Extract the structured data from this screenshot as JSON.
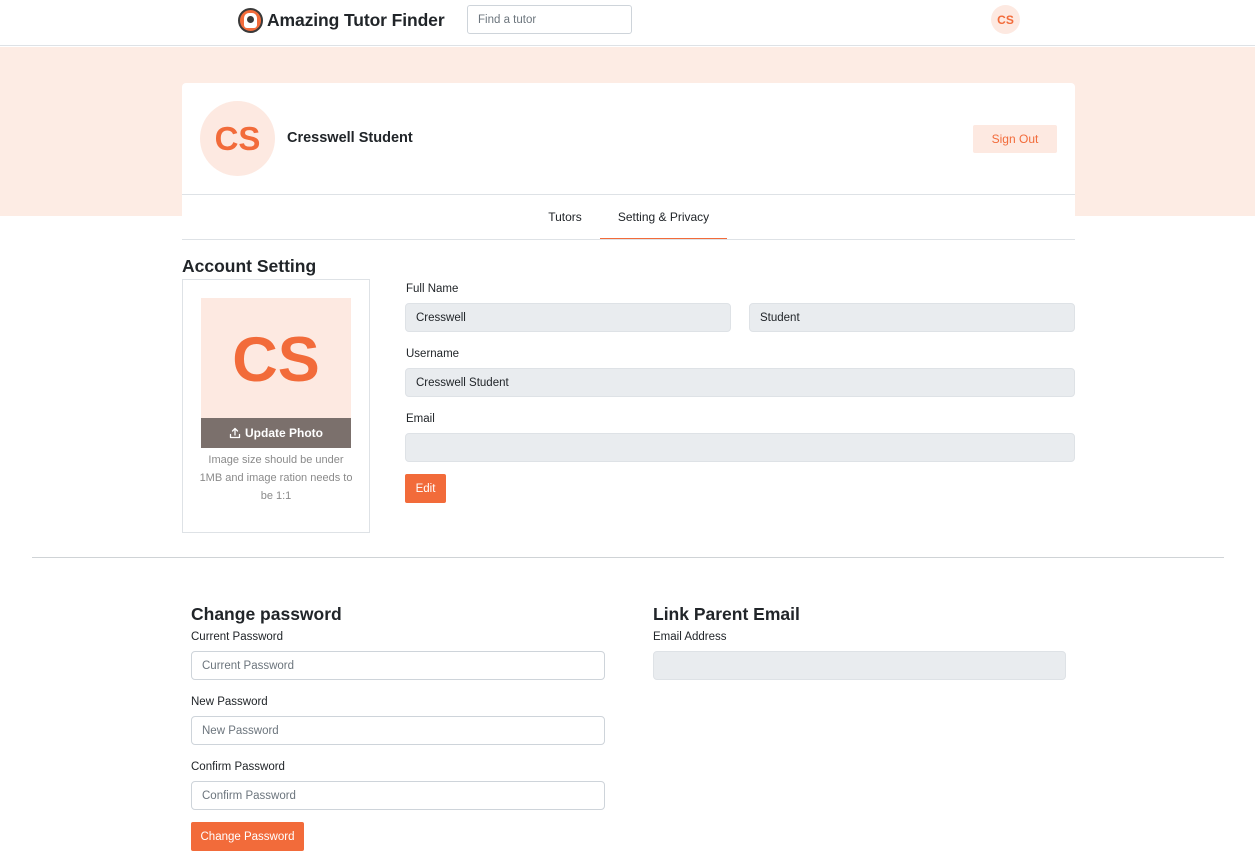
{
  "header": {
    "brand_name": "Amazing Tutor Finder",
    "search_placeholder": "Find a tutor",
    "user_initials": "CS"
  },
  "profile": {
    "initials": "CS",
    "name": "Cresswell Student",
    "sign_out_label": "Sign Out"
  },
  "tabs": [
    {
      "label": "Tutors",
      "active": false
    },
    {
      "label": "Setting & Privacy",
      "active": true
    }
  ],
  "account": {
    "title": "Account Setting",
    "photo_initials": "CS",
    "update_photo_label": "Update Photo",
    "photo_hint": "Image size should be under 1MB and image ration needs to be 1:1",
    "full_name_label": "Full Name",
    "first_name_value": "Cresswell",
    "last_name_value": "Student",
    "username_label": "Username",
    "username_value": "Cresswell Student",
    "email_label": "Email",
    "email_value": "",
    "edit_label": "Edit"
  },
  "change_password": {
    "title": "Change password",
    "current_label": "Current Password",
    "current_placeholder": "Current Password",
    "new_label": "New Password",
    "new_placeholder": "New Password",
    "confirm_label": "Confirm Password",
    "confirm_placeholder": "Confirm Password",
    "submit_label": "Change Password"
  },
  "parent_email": {
    "title": "Link Parent Email",
    "label": "Email Address",
    "value": ""
  },
  "colors": {
    "accent": "#f26b3a",
    "accent_light": "#fde9e1",
    "banner": "#fdece4",
    "readonly_field": "#e9ecef"
  }
}
